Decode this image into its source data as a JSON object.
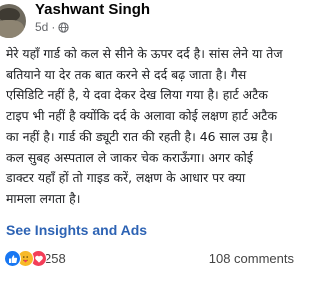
{
  "post": {
    "author": "Yashwant Singh",
    "time": "5d",
    "dot": "·",
    "privacy_icon": "globe-icon",
    "body_lines": [
      "मेरे यहाँ गार्ड को कल से सीने के ऊपर दर्द है। सांस लेने या तेज",
      "बतियाने या देर तक बात करने से दर्द बढ़ जाता है। गैस",
      "एसिडिटि नहीं है, ये दवा देकर देख लिया गया है। हार्ट अटैक",
      "टाइप भी नहीं है क्योंकि दर्द के अलावा कोई लक्षण हार्ट अटैक",
      "का नहीं है। गार्ड की ड्यूटी रात की रहती है। 46 साल उम्र है।",
      "कल सुबह अस्पताल ले जाकर चेक कराऊँगा। अगर कोई",
      "डाक्टर यहाँ हों तो गाइड करें, लक्षण के आधार पर क्या",
      "मामला लगता है।"
    ],
    "insights_link": "See Insights and Ads"
  },
  "stats": {
    "reactions": [
      "like-icon",
      "care-icon",
      "love-icon"
    ],
    "reaction_count": "258",
    "comments": "108 comments"
  },
  "colors": {
    "link": "#2d63b4",
    "like": "#1877f2",
    "care": "#f7b928",
    "love": "#f33e58"
  }
}
